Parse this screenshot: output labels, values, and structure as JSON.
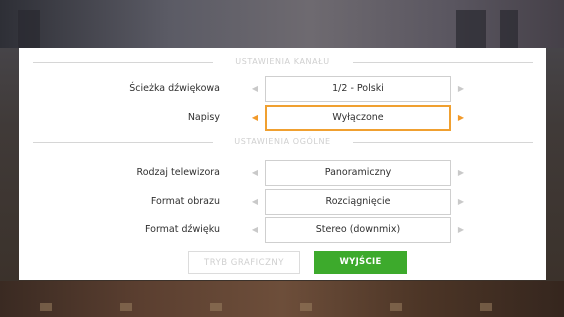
{
  "sections": {
    "channel_title": "USTAWIENIA KANAŁU",
    "general_title": "USTAWIENIA OGÓLNE"
  },
  "settings": {
    "audio_track": {
      "label": "Ścieżka dźwiękowa",
      "value": "1/2 - Polski"
    },
    "subtitles": {
      "label": "Napisy",
      "value": "Wyłączone"
    },
    "tv_type": {
      "label": "Rodzaj telewizora",
      "value": "Panoramiczny"
    },
    "picture_format": {
      "label": "Format obrazu",
      "value": "Rozciągnięcie"
    },
    "sound_format": {
      "label": "Format dźwięku",
      "value": "Stereo (downmix)"
    }
  },
  "buttons": {
    "graphic_mode": "TRYB GRAFICZNY",
    "exit": "WYJŚCIE"
  },
  "icons": {
    "left": "◀",
    "right": "▶"
  },
  "colors": {
    "accent": "#f0a030",
    "exit_green": "#3daa2c"
  }
}
